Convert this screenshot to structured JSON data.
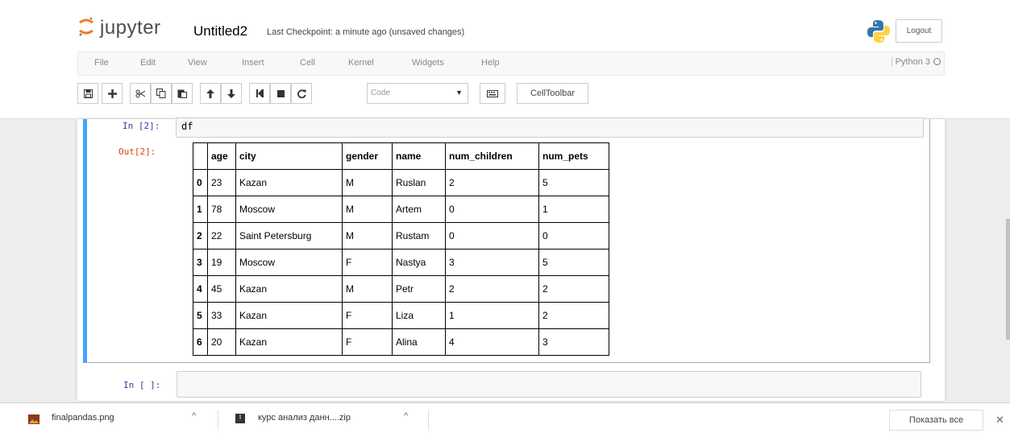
{
  "header": {
    "logo_text": "jupyter",
    "notebook_title": "Untitled2",
    "checkpoint": "Last Checkpoint: a minute ago (unsaved changes)",
    "logout_label": "Logout"
  },
  "menu": {
    "items": [
      "File",
      "Edit",
      "View",
      "Insert",
      "Cell",
      "Kernel",
      "Widgets",
      "Help"
    ],
    "kernel": "Python 3"
  },
  "toolbar": {
    "buttons": [
      "save-icon",
      "plus-icon",
      "scissors-icon",
      "copy-icon",
      "paste-icon",
      "arrow-up-icon",
      "arrow-down-icon",
      "step-icon",
      "stop-icon",
      "restart-icon"
    ],
    "cell_type": "Code",
    "celltoolbar_label": "CellToolbar"
  },
  "cells": {
    "cell1": {
      "in_prompt": "In [2]:",
      "code": "df",
      "out_prompt": "Out[2]:"
    },
    "cell2": {
      "in_prompt": "In [ ]:"
    }
  },
  "dataframe": {
    "columns": [
      "",
      "age",
      "city",
      "gender",
      "name",
      "num_children",
      "num_pets"
    ],
    "rows": [
      [
        "0",
        "23",
        "Kazan",
        "M",
        "Ruslan",
        "2",
        "5"
      ],
      [
        "1",
        "78",
        "Moscow",
        "M",
        "Artem",
        "0",
        "1"
      ],
      [
        "2",
        "22",
        "Saint Petersburg",
        "M",
        "Rustam",
        "0",
        "0"
      ],
      [
        "3",
        "19",
        "Moscow",
        "F",
        "Nastya",
        "3",
        "5"
      ],
      [
        "4",
        "45",
        "Kazan",
        "M",
        "Petr",
        "2",
        "2"
      ],
      [
        "5",
        "33",
        "Kazan",
        "F",
        "Liza",
        "1",
        "2"
      ],
      [
        "6",
        "20",
        "Kazan",
        "F",
        "Alina",
        "4",
        "3"
      ]
    ]
  },
  "downloads": {
    "item1": "finalpandas.png",
    "item2": "курс анализ данн....zip",
    "show_all": "Показать все"
  },
  "colors": {
    "selected_cell_border": "#42a5f5",
    "in_prompt": "#303f9f",
    "out_prompt": "#d84315"
  }
}
